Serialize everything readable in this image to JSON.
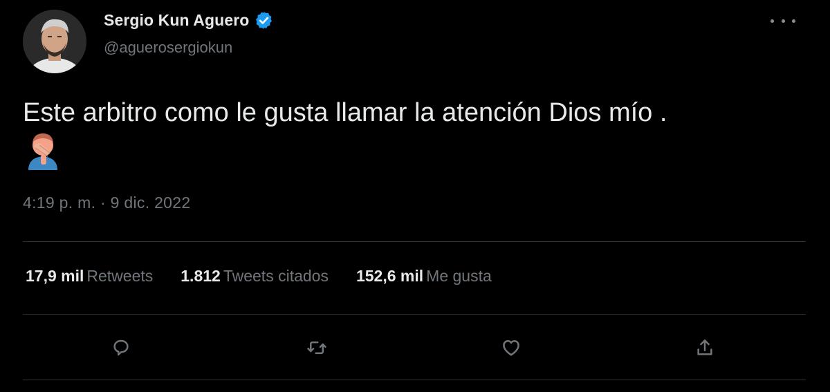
{
  "author": {
    "display_name": "Sergio Kun Aguero",
    "handle": "@aguerosergiokun",
    "verified": true
  },
  "tweet": {
    "text": "Este arbitro como le gusta llamar la atención Dios mío .",
    "emoji": "man-facepalming",
    "timestamp": "4:19 p. m. · 9 dic. 2022"
  },
  "stats": [
    {
      "value": "17,9 mil",
      "label": "Retweets"
    },
    {
      "value": "1.812",
      "label": "Tweets citados"
    },
    {
      "value": "152,6 mil",
      "label": "Me gusta"
    }
  ],
  "actions": [
    "reply-icon",
    "retweet-icon",
    "like-icon",
    "share-icon"
  ],
  "colors": {
    "background": "#000000",
    "primary_text": "#e7e9ea",
    "secondary_text": "#71767b",
    "verified_blue": "#1d9bf0",
    "divider": "#2f3336"
  }
}
